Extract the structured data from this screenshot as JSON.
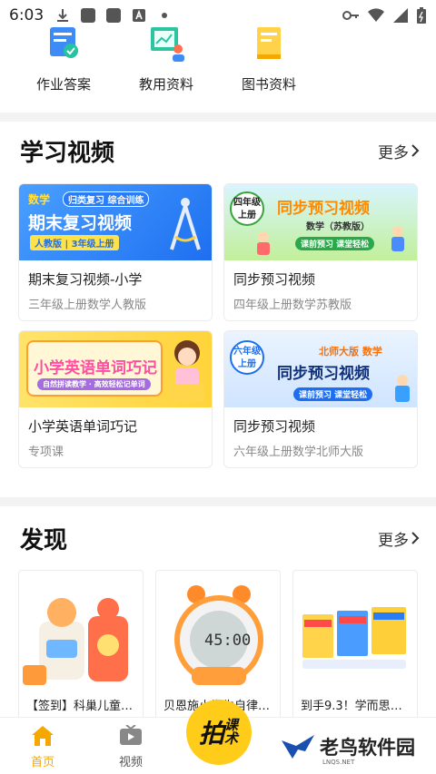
{
  "status_bar": {
    "time": "6:03"
  },
  "quick_links": [
    {
      "label": "作业答案",
      "icon": "homework-answer-icon"
    },
    {
      "label": "教用资料",
      "icon": "teaching-material-icon"
    },
    {
      "label": "图书资料",
      "icon": "book-material-icon"
    }
  ],
  "videos": {
    "title": "学习视频",
    "more": "更多",
    "cards": [
      {
        "title": "期末复习视频-小学",
        "subtitle": "三年级上册数学人教版",
        "thumb": {
          "tag": "数学",
          "banner": "归类复习 综合训练",
          "headline": "期末复习视频",
          "pill": "人教版 | 3年级上册"
        }
      },
      {
        "title": "同步预习视频",
        "subtitle": "四年级上册数学苏教版",
        "thumb": {
          "grade": "四年级上册",
          "headline": "同步预习视频",
          "tag": "数学（苏教版）",
          "pill": "课前预习 课堂轻松"
        }
      },
      {
        "title": "小学英语单词巧记",
        "subtitle": "专项课",
        "thumb": {
          "headline": "小学英语单词巧记",
          "pill": "自然拼读教学 · 高效轻松记单词"
        }
      },
      {
        "title": "同步预习视频",
        "subtitle": "六年级上册数学北师大版",
        "thumb": {
          "grade": "六年级上册",
          "tag": "北师大版 数学",
          "headline": "同步预习视频",
          "pill": "课前预习 课堂轻松"
        }
      }
    ]
  },
  "discover": {
    "title": "发现",
    "more": "更多",
    "items": [
      {
        "title": "【签到】科巢儿童…"
      },
      {
        "title": "贝恩施小学生自律…",
        "clock": "45:00"
      },
      {
        "title": "到手9.3！学而思新…"
      }
    ]
  },
  "bottom_nav": {
    "items": [
      {
        "label": "首页",
        "active": true
      },
      {
        "label": "视频",
        "active": false
      }
    ],
    "center": {
      "main": "拍",
      "side": "课术"
    }
  },
  "watermark": {
    "text": "老鸟软件园",
    "sub": "LNQS.NET"
  },
  "colors": {
    "accent": "#f5a800",
    "center": "#ffcc1a"
  }
}
